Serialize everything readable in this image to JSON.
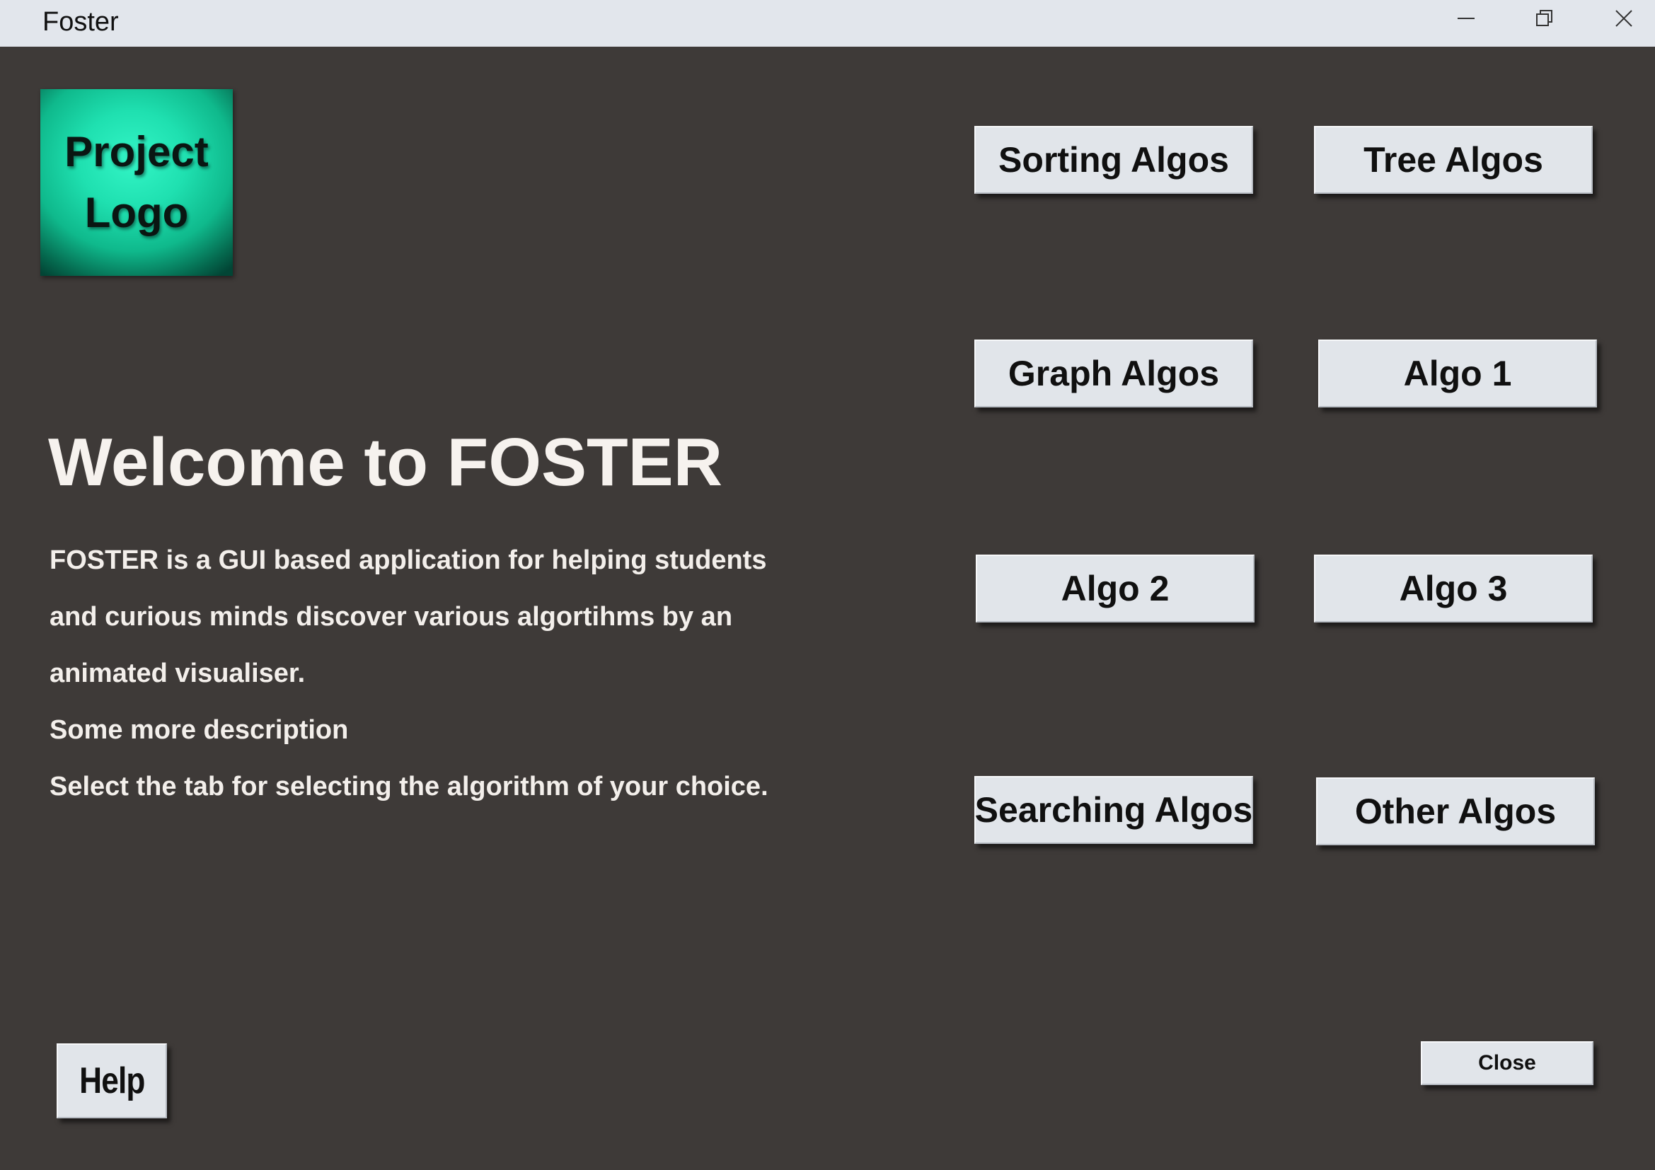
{
  "window": {
    "title": "Foster"
  },
  "logo": {
    "line1": "Project",
    "line2": "Logo"
  },
  "welcome": {
    "heading": "Welcome to FOSTER",
    "description": [
      "FOSTER is a GUI based application for helping students",
      "and curious minds discover various algortihms by an",
      "animated visualiser.",
      "Some more description",
      "Select the tab for selecting the algorithm of your choice."
    ]
  },
  "algorithms": {
    "sorting": "Sorting Algos",
    "tree": "Tree Algos",
    "graph": "Graph Algos",
    "algo1": "Algo 1",
    "algo2": "Algo 2",
    "algo3": "Algo 3",
    "searching": "Searching Algos",
    "other": "Other Algos"
  },
  "footer": {
    "help_label": "Help",
    "close_label": "Close"
  },
  "colors": {
    "background": "#3e3a38",
    "titlebar": "#e2e6ec",
    "button_face": "#e1e5ea",
    "logo_accent": "#1fe0b0",
    "text_light": "#f6f2ee"
  },
  "icons": {
    "minimize": "minimize-icon",
    "restore": "restore-icon",
    "close": "close-icon"
  }
}
